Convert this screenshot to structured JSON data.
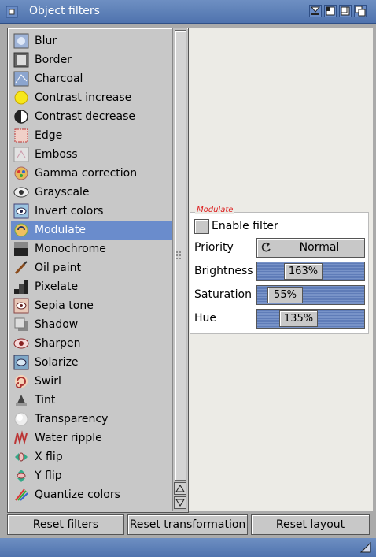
{
  "window": {
    "title": "Object filters",
    "accent": "#5a7dba"
  },
  "filters": [
    {
      "label": "Blur",
      "icon": "blur-icon"
    },
    {
      "label": "Border",
      "icon": "border-icon"
    },
    {
      "label": "Charcoal",
      "icon": "charcoal-icon"
    },
    {
      "label": "Contrast increase",
      "icon": "contrast-increase-icon"
    },
    {
      "label": "Contrast decrease",
      "icon": "contrast-decrease-icon"
    },
    {
      "label": "Edge",
      "icon": "edge-icon"
    },
    {
      "label": "Emboss",
      "icon": "emboss-icon"
    },
    {
      "label": "Gamma correction",
      "icon": "gamma-correction-icon"
    },
    {
      "label": "Grayscale",
      "icon": "grayscale-icon"
    },
    {
      "label": "Invert colors",
      "icon": "invert-colors-icon"
    },
    {
      "label": "Modulate",
      "icon": "modulate-icon",
      "selected": true
    },
    {
      "label": "Monochrome",
      "icon": "monochrome-icon"
    },
    {
      "label": "Oil paint",
      "icon": "oil-paint-icon"
    },
    {
      "label": "Pixelate",
      "icon": "pixelate-icon"
    },
    {
      "label": "Sepia tone",
      "icon": "sepia-tone-icon"
    },
    {
      "label": "Shadow",
      "icon": "shadow-icon"
    },
    {
      "label": "Sharpen",
      "icon": "sharpen-icon"
    },
    {
      "label": "Solarize",
      "icon": "solarize-icon"
    },
    {
      "label": "Swirl",
      "icon": "swirl-icon"
    },
    {
      "label": "Tint",
      "icon": "tint-icon"
    },
    {
      "label": "Transparency",
      "icon": "transparency-icon"
    },
    {
      "label": "Water ripple",
      "icon": "water-ripple-icon"
    },
    {
      "label": "X flip",
      "icon": "x-flip-icon"
    },
    {
      "label": "Y flip",
      "icon": "y-flip-icon"
    },
    {
      "label": "Quantize colors",
      "icon": "quantize-colors-icon"
    }
  ],
  "settings": {
    "group_title": "Modulate",
    "enable_label": "Enable filter",
    "enable_checked": false,
    "priority_label": "Priority",
    "priority_value": "Normal",
    "brightness_label": "Brightness",
    "brightness_value": "163%",
    "saturation_label": "Saturation",
    "saturation_value": "55%",
    "hue_label": "Hue",
    "hue_value": "135%"
  },
  "buttons": {
    "reset_filters": "Reset filters",
    "reset_transformation": "Reset transformation",
    "reset_layout": "Reset layout"
  }
}
